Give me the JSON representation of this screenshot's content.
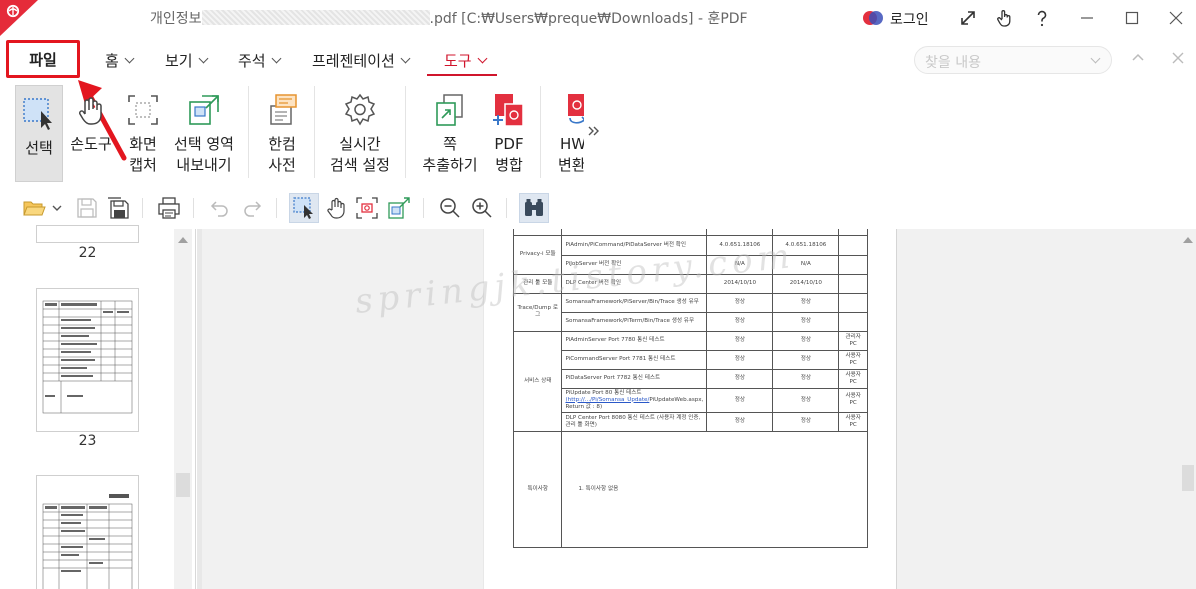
{
  "titlebar": {
    "title_prefix": "개인정보",
    "title_suffix": ".pdf [C:₩Users₩preque₩Downloads] - 훈PDF",
    "login_label": "로그인"
  },
  "menu": {
    "file_tab": "파일",
    "tabs": [
      {
        "label": "홈"
      },
      {
        "label": "보기"
      },
      {
        "label": "주석"
      },
      {
        "label": "프레젠테이션"
      },
      {
        "label": "도구",
        "active": true
      }
    ],
    "search_placeholder": "찾을 내용"
  },
  "ribbon": {
    "select": "선택",
    "hand": "손도구",
    "capture": [
      "화면",
      "캡처"
    ],
    "export": [
      "선택 영역",
      "내보내기"
    ],
    "dict": [
      "한컴",
      "사전"
    ],
    "realtime": [
      "실시간",
      "검색 설정"
    ],
    "extract": [
      "쪽",
      "추출하기"
    ],
    "merge": [
      "PDF",
      "병합"
    ],
    "hwp": [
      "HW",
      "변환"
    ]
  },
  "thumbnails": {
    "pages": [
      "22",
      "23"
    ]
  },
  "document": {
    "watermark": "springjk.tistory.com",
    "rows": [
      {
        "group": "Privacy-i 모듈",
        "item": "PiAdmin/PiCommand/PiDataServer 버전 확인",
        "v1": "4.0.651.18106",
        "v2": "4.0.651.18106",
        "note": ""
      },
      {
        "group": "",
        "item": "PiJobServer 버전 확인",
        "v1": "N/A",
        "v2": "N/A",
        "note": ""
      },
      {
        "group": "관리 툴 모듈",
        "item": "DLP Center 버전 확인",
        "v1": "2014/10/10",
        "v2": "2014/10/10",
        "note": ""
      },
      {
        "group": "Trace/Dump 로그",
        "item": "SomansaFramework/PiServer/Bin/Trace 생성 유무",
        "v1": "정상",
        "v2": "정상",
        "note": ""
      },
      {
        "group": "",
        "item": "SomansaFramework/PiTerm/Bin/Trace 생성 유무",
        "v1": "정상",
        "v2": "정상",
        "note": ""
      },
      {
        "group": "서비스 상태",
        "item": "PiAdminServer Port 7780 통신 테스트",
        "v1": "정상",
        "v2": "정상",
        "note": "관리자 PC"
      },
      {
        "group": "",
        "item": "PiCommandServer Port 7781 통신 테스트",
        "v1": "정상",
        "v2": "정상",
        "note": "사용자 PC"
      },
      {
        "group": "",
        "item": "PiDataServer Port 7782 통신 테스트",
        "v1": "정상",
        "v2": "정상",
        "note": "사용자 PC"
      },
      {
        "group": "",
        "item": "PiUpdate Port 80 통신 테스트",
        "link": "(http://.../Pi/Somansa_Update/",
        "item2": "PiUpdateWeb.aspx, Return 값 : 8)",
        "v1": "정상",
        "v2": "정상",
        "note": "사용자 PC"
      },
      {
        "group": "",
        "item": "DLP Center Port 8080 통신 테스트 (사용자 계정 인증, 관리 툴 화면)",
        "v1": "정상",
        "v2": "정상",
        "note": "사용자 PC"
      }
    ],
    "special_label": "특이사항",
    "special_text": "1.   특이사항 없음"
  }
}
